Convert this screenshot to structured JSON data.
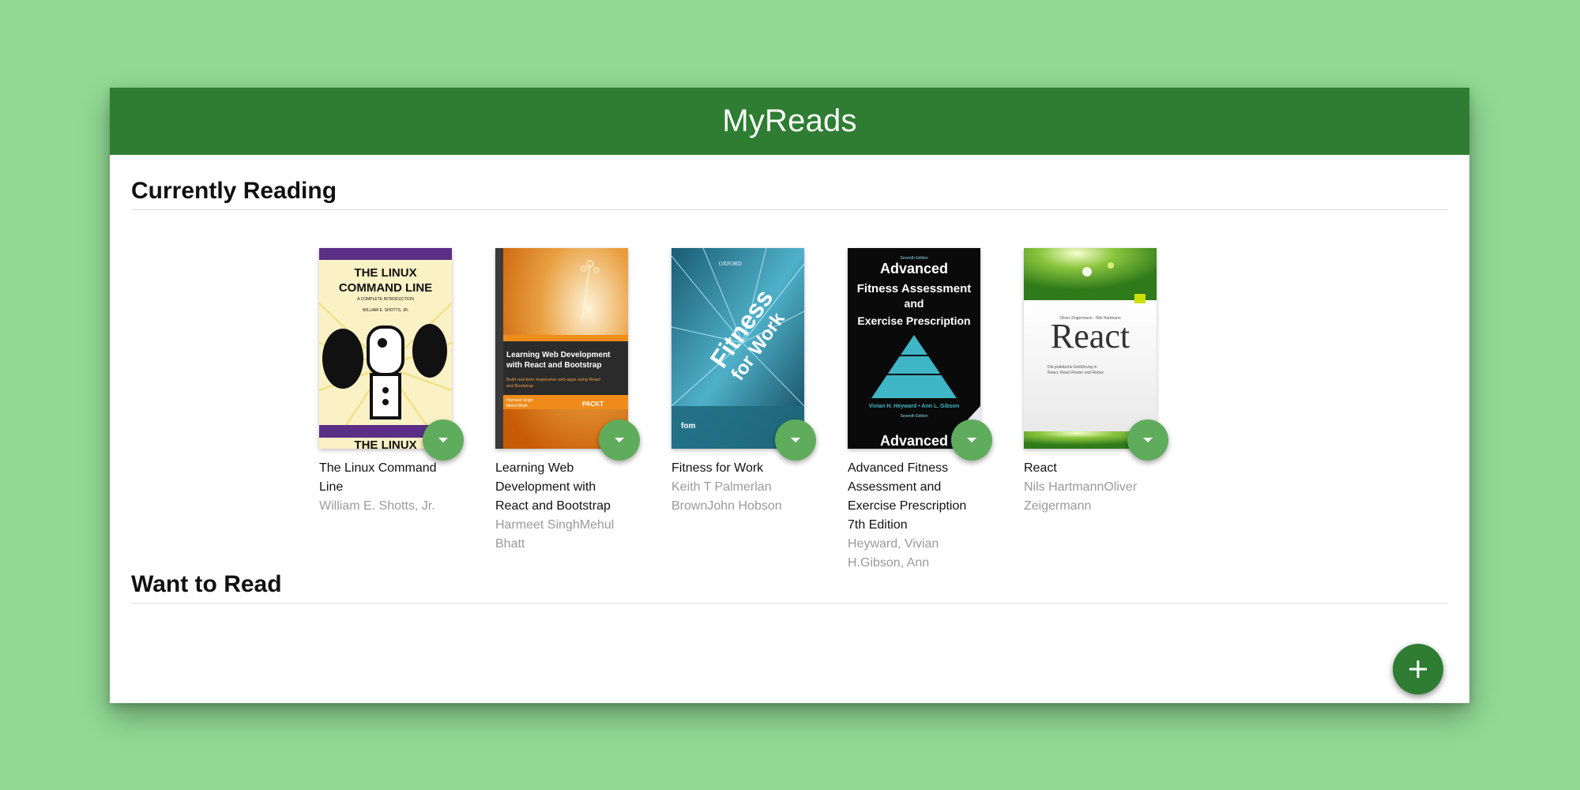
{
  "header": {
    "title": "MyReads"
  },
  "shelves": [
    {
      "title": "Currently Reading",
      "books": [
        {
          "title": "The Linux Command Line",
          "authors": "William E. Shotts, Jr.",
          "cover": {
            "line1": "THE LINUX",
            "line2": "COMMAND LINE",
            "line3": "A COMPLETE INTRODUCTION",
            "line4": "WILLIAM E. SHOTTS, JR.",
            "bottom": "THE LINUX"
          }
        },
        {
          "title": "Learning Web Development with React and Bootstrap",
          "authors": "Harmeet SinghMehul Bhatt",
          "cover": {
            "heading": "Learning Web Development with React and Bootstrap",
            "sub": "Build real-time responsive web apps using React and Bootstrap",
            "authors": "Harmeet Singh Mehul Bhatt",
            "publisher": "PACKT"
          }
        },
        {
          "title": "Fitness for Work",
          "authors": "Keith T Palmerlan BrownJohn Hobson",
          "cover": {
            "word1": "Fitness",
            "word2": "for Work",
            "publisher": "OXFORD",
            "footer": "fom"
          }
        },
        {
          "title": "Advanced Fitness Assessment and Exercise Prescription 7th Edition",
          "authors": "Heyward, Vivian H.Gibson, Ann",
          "cover": {
            "edition": "Seventh Edition",
            "line1": "Advanced",
            "line2": "Fitness Assessment",
            "line3": "and",
            "line4": "Exercise Prescription",
            "authors": "Vivian H. Heyward • Ann L. Gibson",
            "bottom": "Advanced"
          }
        },
        {
          "title": "React",
          "authors": "Nils HartmannOliver Zeigermann",
          "cover": {
            "authors": "Oliver Zeigermann · Nils Hartmann",
            "title": "React",
            "sub": "Die praktische Einführung in React, React Router und Redux"
          }
        }
      ]
    },
    {
      "title": "Want to Read"
    }
  ],
  "icons": {
    "shelf_changer": "arrow-drop-down-icon",
    "open_search": "add-icon"
  },
  "colors": {
    "background": "#91d994",
    "header": "#2e7d32",
    "shelf_changer": "#60ac5d",
    "add_button": "#2e7d32"
  }
}
